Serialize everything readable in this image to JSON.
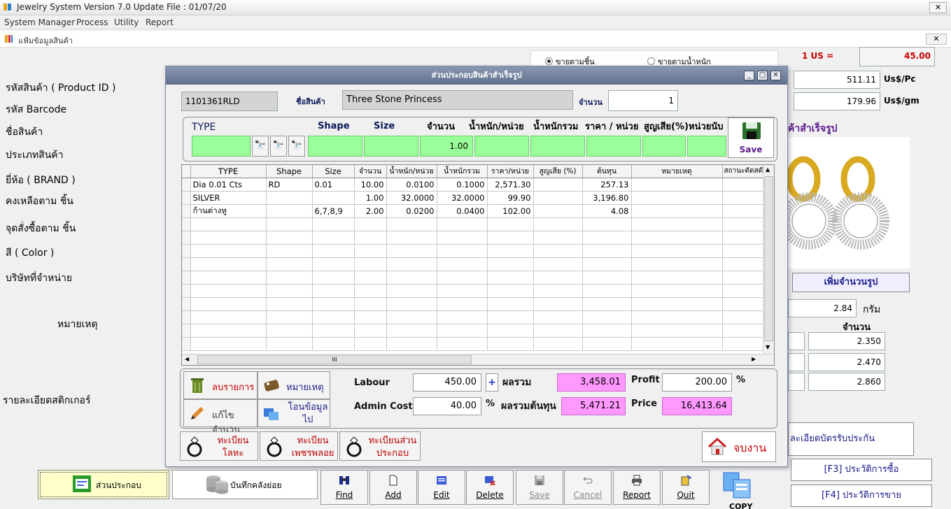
{
  "window": {
    "title": "Jewelry System Version 7.0 Update File : 01/07/20",
    "close": "✕"
  },
  "menu": [
    "System Manager",
    "Process",
    "Utility",
    "Report"
  ],
  "subwindow": {
    "title": "แฟ้มข้อมูลสินค้า",
    "close": "✕"
  },
  "left_labels": [
    "รหัสสินค้า ( Product ID )",
    "รหัส Barcode",
    "ชื่อสินค้า",
    "ประเภทสินค้า",
    "ยี่ห้อ ( BRAND )",
    "คงเหลือตาม ชิ้น",
    "จุดสั่งซื้อตาม ชิ้น",
    "สี ( Color )",
    "บริษัทที่จำหน่าย",
    "หมายเหตุ",
    "รายละเอียดสติกเกอร์"
  ],
  "pricing_mode": {
    "option1": "ขายตามชิ้น",
    "option2": "ขายตามน้ำหนัก",
    "selected": "option1"
  },
  "rate": {
    "label": "1 US =",
    "value": "45.00",
    "per_pc": "511.11",
    "per_pc_unit": "Us$/Pc",
    "per_gm": "179.96",
    "per_gm_unit": "Us$/gm"
  },
  "right_panel": {
    "image_caption": "ค้าสำเร็จรูป",
    "add_image": "เพิ่มจำนวนรูป",
    "weight": "2.84",
    "weight_unit": "กรัม",
    "qty_header": "จำนวน",
    "qty_values": [
      "2.350",
      "2.470",
      "2.860"
    ],
    "warranty": "ละเอียดบัตรรับประกัน",
    "f3": "[F3] ประวัติการซื้อ",
    "f4": "[F4] ประวัติการขาย"
  },
  "dialog": {
    "title": "ส่วนประกอบสินค้าสำเร็จรูป",
    "product_id": "1101361RLD",
    "name_label": "ชื่อสินค้า",
    "name_value": "Three Stone Princess",
    "qty_label": "จำนวน",
    "qty_value": "1",
    "entry_headers": {
      "type": "TYPE",
      "shape": "Shape",
      "size": "Size",
      "qty": "จำนวน",
      "wt_unit": "น้ำหนัก/หน่วย",
      "wt_total": "น้ำหนักรวม",
      "price_unit": "ราคา / หน่วย",
      "loss": "สูญเสีย(%)",
      "unit_count": "หน่วยนับ"
    },
    "entry_qty": "1.00",
    "save": "Save",
    "grid_headers": [
      "TYPE",
      "Shape",
      "Size",
      "จำนวน",
      "น้ำหนัก/หน่วย",
      "น้ำหนักรวม",
      "ราคา/หน่วย",
      "สูญเสีย (%)",
      "ต้นทุน",
      "หมายเหตุ",
      "สถานะตัดสต๊อก"
    ],
    "rows": [
      [
        "Dia 0.01 Cts",
        "RD",
        "0.01",
        "10.00",
        "0.0100",
        "0.1000",
        "2,571.30",
        "",
        "257.13",
        "",
        "0"
      ],
      [
        "SILVER",
        "",
        "",
        "1.00",
        "32.0000",
        "32.0000",
        "99.90",
        "",
        "3,196.80",
        "",
        "0"
      ],
      [
        "ก้านต่างหู",
        "",
        "6,7,8,9",
        "2.00",
        "0.0200",
        "0.0400",
        "102.00",
        "",
        "4.08",
        "",
        "0"
      ]
    ],
    "hscroll_mark": "III",
    "buttons": {
      "delete": "ลบรายการ",
      "note": "หมายเหตุ",
      "edit_qty": "แก้ไขจำนวน",
      "transfer": "โอนข้อมูลไป"
    },
    "labour_label": "Labour",
    "labour": "450.00",
    "plus": "+",
    "admin_label": "Admin Cost",
    "admin": "40.00",
    "pct": "%",
    "total_label": "ผลรวม",
    "total": "3,458.01",
    "cost_label": "ผลรวมต้นทุน",
    "cost": "5,471.21",
    "profit_label": "Profit",
    "profit": "200.00",
    "profit_pct": "%",
    "price_label": "Price",
    "price": "16,413.64",
    "ring_buttons": [
      "ทะเบียนโลหะ",
      "ทะเบียนเพชรพลอย",
      "ทะเบียนส่วนประกอบ"
    ],
    "finish": "จบงาน"
  },
  "toolbar": {
    "components": "ส่วนประกอบ",
    "stock": "บันทึกคลังย่อย",
    "find": "Find",
    "add": "Add",
    "edit": "Edit",
    "delete": "Delete",
    "save": "Save",
    "cancel": "Cancel",
    "report": "Report",
    "quit": "Quit",
    "copy": "COPY"
  },
  "colors": {
    "green": "#99ff99",
    "pink": "#ff99ff",
    "red": "#cc0000"
  }
}
